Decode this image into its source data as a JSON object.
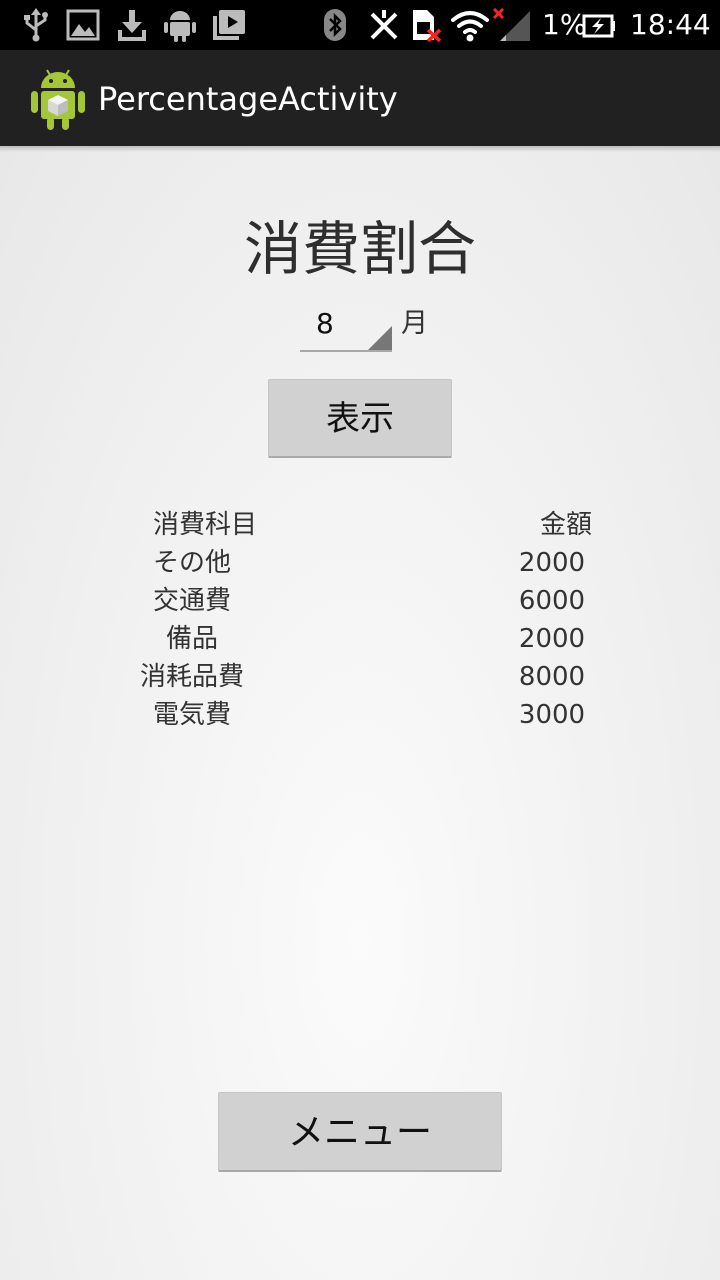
{
  "status_bar": {
    "battery_percent_label": "1%",
    "time": "18:44",
    "icons": [
      "usb-icon",
      "gallery-icon",
      "download-icon",
      "android-debug-icon",
      "media-icon",
      "bluetooth-icon",
      "nfc-icon",
      "sim-error-icon",
      "wifi-icon",
      "signal-icon",
      "battery-charging-icon"
    ]
  },
  "action_bar": {
    "title": "PercentageActivity",
    "icon": "android-app-icon"
  },
  "main": {
    "title": "消費割合",
    "month_spinner": {
      "value": "8"
    },
    "month_unit": "月",
    "show_button": "表示",
    "table": {
      "headers": [
        "消費科目",
        "金額"
      ],
      "rows": [
        [
          "その他",
          "2000"
        ],
        [
          "交通費",
          "6000"
        ],
        [
          "備品",
          "2000"
        ],
        [
          "消耗品費",
          "8000"
        ],
        [
          "電気費",
          "3000"
        ]
      ]
    },
    "menu_button": "メニュー"
  },
  "colors": {
    "status_bar": "#000000",
    "action_bar": "#212121",
    "background": "#f1f1f1",
    "button": "#d1d1d1",
    "android_green": "#a4c639"
  }
}
